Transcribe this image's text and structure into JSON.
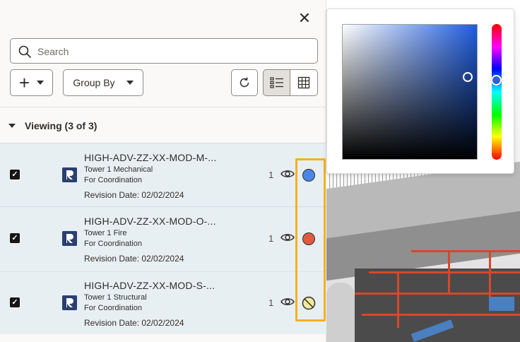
{
  "panel": {
    "close_icon": "close-icon",
    "search": {
      "placeholder": "Search",
      "value": ""
    },
    "toolbar": {
      "add_icon": "plus-icon",
      "group_by_label": "Group By",
      "refresh_icon": "refresh-icon",
      "list_view_icon": "list-view-icon",
      "grid_view_icon": "grid-view-icon"
    },
    "viewing_label": "Viewing (3 of 3)",
    "models": [
      {
        "name": "HIGH-ADV-ZZ-XX-MOD-M-...",
        "line1": "Tower 1 Mechanical",
        "line2": "For Coordination",
        "revision": "Revision Date: 02/02/2024",
        "count": "1",
        "checked": true,
        "color": "#4a86e8"
      },
      {
        "name": "HIGH-ADV-ZZ-XX-MOD-O-...",
        "line1": "Tower 1 Fire",
        "line2": "For Coordination",
        "revision": "Revision Date: 02/02/2024",
        "count": "1",
        "checked": true,
        "color": "#e05a3f"
      },
      {
        "name": "HIGH-ADV-ZZ-XX-MOD-S-...",
        "line1": "Tower 1 Structural",
        "line2": "For Coordination",
        "revision": "Revision Date: 02/02/2024",
        "count": "1",
        "checked": true,
        "color": "none"
      }
    ]
  },
  "color_picker": {
    "hue_color": "#1f5de0",
    "selected_color": "#2c61d8"
  },
  "colors": {
    "accent_highlight": "#f3b120",
    "row_background": "#e8eff3"
  }
}
